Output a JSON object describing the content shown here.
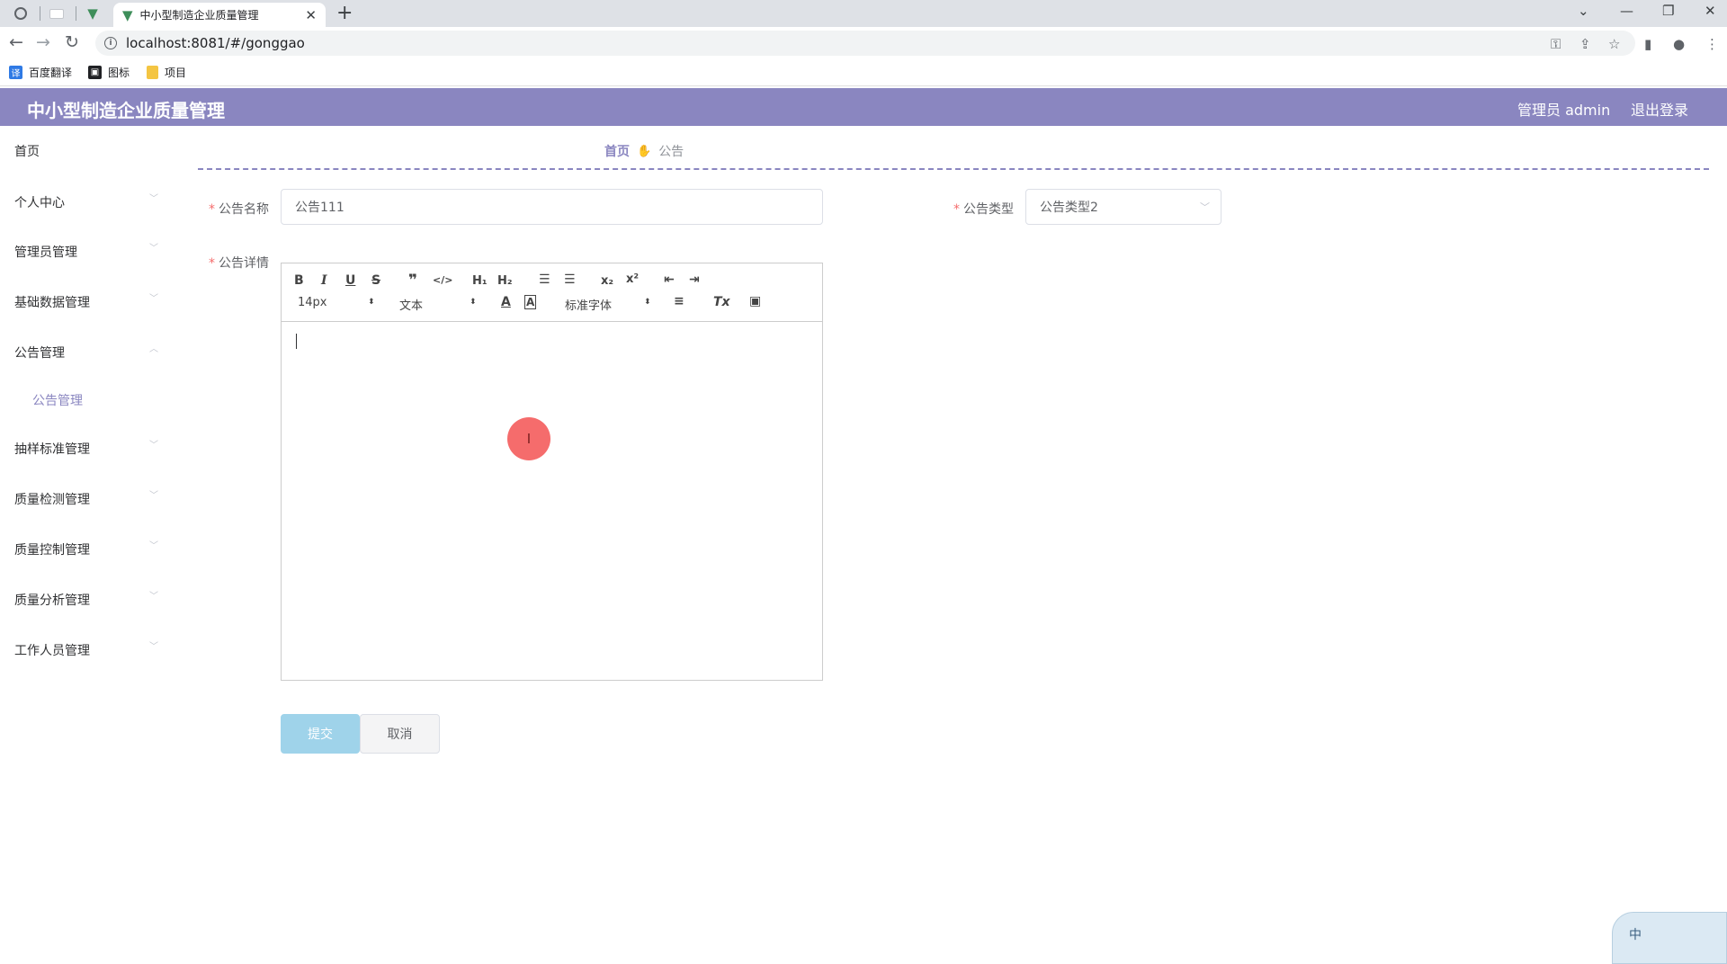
{
  "browser": {
    "tab_title": "中小型制造企业质量管理",
    "url": "localhost:8081/#/gonggao",
    "bookmarks": [
      {
        "label": "百度翻译",
        "color": "#2f7ae5"
      },
      {
        "label": "图标",
        "color": "#202124"
      },
      {
        "label": "项目",
        "color": "#f4c542"
      }
    ]
  },
  "header": {
    "title": "中小型制造企业质量管理",
    "user": "管理员 admin",
    "logout": "退出登录",
    "color": "#8a86c0"
  },
  "sidebar": {
    "items": [
      {
        "label": "首页"
      },
      {
        "label": "个人中心"
      },
      {
        "label": "管理员管理"
      },
      {
        "label": "基础数据管理"
      },
      {
        "label": "公告管理"
      },
      {
        "label": "抽样标准管理"
      },
      {
        "label": "质量检测管理"
      },
      {
        "label": "质量控制管理"
      },
      {
        "label": "质量分析管理"
      },
      {
        "label": "工作人员管理"
      }
    ],
    "active_sub": "公告管理"
  },
  "breadcrumb": {
    "home": "首页",
    "current": "公告"
  },
  "form": {
    "name_label": "公告名称",
    "name_value": "公告111",
    "type_label": "公告类型",
    "type_value": "公告类型2",
    "detail_label": "公告详情",
    "required_mark": "*"
  },
  "editor": {
    "size": "14px",
    "header_picker": "文本",
    "font_picker": "标准字体"
  },
  "buttons": {
    "submit": "提交",
    "cancel": "取消"
  },
  "ime": {
    "char": "中"
  }
}
